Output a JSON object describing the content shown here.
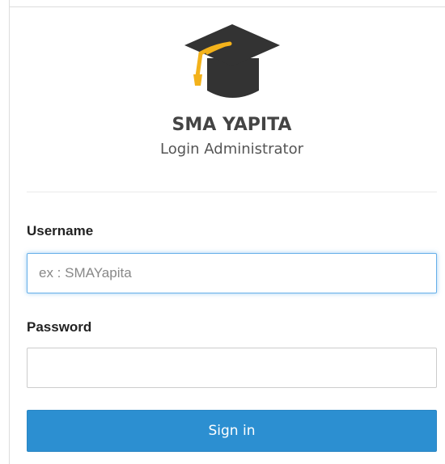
{
  "header": {
    "logo_icon": "graduation-cap-icon",
    "app_name": "SMA YAPITA",
    "subtitle": "Login Administrator"
  },
  "form": {
    "username": {
      "label": "Username",
      "placeholder": "ex : SMAYapita",
      "value": "",
      "focused": true
    },
    "password": {
      "label": "Password",
      "placeholder": "",
      "value": ""
    },
    "submit_label": "Sign in"
  },
  "colors": {
    "cap": "#333333",
    "tassel": "#f3b21b",
    "button": "#2c8fd1",
    "focus_border": "#66afe9"
  }
}
